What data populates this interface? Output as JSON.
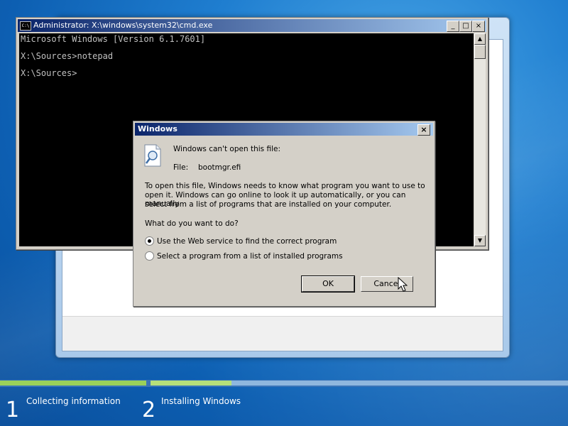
{
  "cmd": {
    "title": "Administrator: X:\\windows\\system32\\cmd.exe",
    "icon_text": "C:\\",
    "lines": [
      "Microsoft Windows [Version 6.1.7601]",
      "",
      "X:\\Sources>notepad",
      "",
      "X:\\Sources>"
    ]
  },
  "dialog": {
    "title": "Windows",
    "heading": "Windows can't open this file:",
    "file_label": "File:",
    "file_name": "bootmgr.efi",
    "description_1": "To open this file, Windows needs to know what program you want to use to",
    "description_2": "open it. Windows can go online to look it up automatically, or you can manually",
    "description_3": "select from a list of programs that are installed on your computer.",
    "question": "What do you want to do?",
    "options": [
      {
        "label": "Use the Web service to find the correct program",
        "selected": true
      },
      {
        "label": "Select a program from a list of installed programs",
        "selected": false
      }
    ],
    "ok_label": "OK",
    "cancel_label": "Cancel",
    "close_glyph": "×"
  },
  "setup": {
    "steps": [
      {
        "number": "1",
        "label": "Collecting information"
      },
      {
        "number": "2",
        "label": "Installing Windows"
      }
    ]
  },
  "colors": {
    "progress_done": "#9ad15a",
    "progress_active": "#b6e07a",
    "progress_remaining": "#8fb7de"
  }
}
